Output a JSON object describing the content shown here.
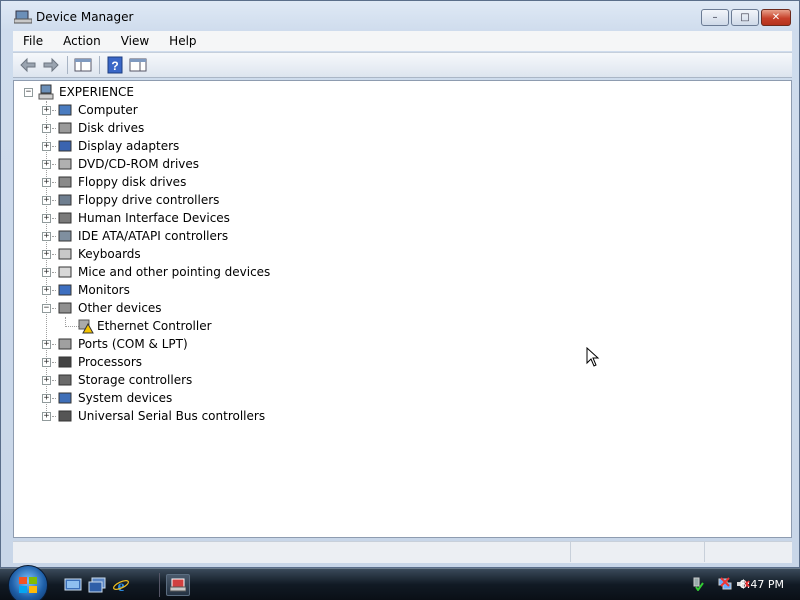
{
  "window": {
    "title": "Device Manager",
    "buttons": {
      "minimize": "–",
      "maximize": "□",
      "close": "✕"
    }
  },
  "menu": [
    "File",
    "Action",
    "View",
    "Help"
  ],
  "toolbar": {
    "buttons": [
      "back-icon",
      "forward-icon",
      "show-hide-console-tree-icon",
      "help-icon",
      "properties-pane-icon"
    ]
  },
  "tree": {
    "root": "EXPERIENCE",
    "categories": [
      {
        "label": "Computer",
        "icon": "computer-icon",
        "expanded": false
      },
      {
        "label": "Disk drives",
        "icon": "disk-drive-icon",
        "expanded": false
      },
      {
        "label": "Display adapters",
        "icon": "display-adapter-icon",
        "expanded": false
      },
      {
        "label": "DVD/CD-ROM drives",
        "icon": "dvd-drive-icon",
        "expanded": false
      },
      {
        "label": "Floppy disk drives",
        "icon": "floppy-drive-icon",
        "expanded": false
      },
      {
        "label": "Floppy drive controllers",
        "icon": "floppy-controller-icon",
        "expanded": false
      },
      {
        "label": "Human Interface Devices",
        "icon": "hid-icon",
        "expanded": false
      },
      {
        "label": "IDE ATA/ATAPI controllers",
        "icon": "ide-controller-icon",
        "expanded": false
      },
      {
        "label": "Keyboards",
        "icon": "keyboard-icon",
        "expanded": false
      },
      {
        "label": "Mice and other pointing devices",
        "icon": "mouse-icon",
        "expanded": false
      },
      {
        "label": "Monitors",
        "icon": "monitor-icon",
        "expanded": false
      },
      {
        "label": "Other devices",
        "icon": "unknown-device-icon",
        "expanded": true,
        "children": [
          {
            "label": "Ethernet Controller",
            "icon": "warning-device-icon"
          }
        ]
      },
      {
        "label": "Ports (COM & LPT)",
        "icon": "port-icon",
        "expanded": false
      },
      {
        "label": "Processors",
        "icon": "processor-icon",
        "expanded": false
      },
      {
        "label": "Storage controllers",
        "icon": "storage-controller-icon",
        "expanded": false
      },
      {
        "label": "System devices",
        "icon": "system-device-icon",
        "expanded": false
      },
      {
        "label": "Universal Serial Bus controllers",
        "icon": "usb-icon",
        "expanded": false
      }
    ]
  },
  "taskbar": {
    "clock": "8:47 PM",
    "quick_launch": [
      "show-desktop-icon",
      "switch-windows-icon",
      "internet-explorer-icon"
    ],
    "tasks": [
      "device-manager-task-icon"
    ],
    "tray": [
      "safely-remove-hardware-icon",
      "network-disconnected-icon",
      "volume-muted-icon"
    ]
  },
  "colors": {
    "title_gradient": "#cfdced",
    "taskbar": "#111a24",
    "warning": "#f5c400",
    "close_button": "#c7412a"
  }
}
